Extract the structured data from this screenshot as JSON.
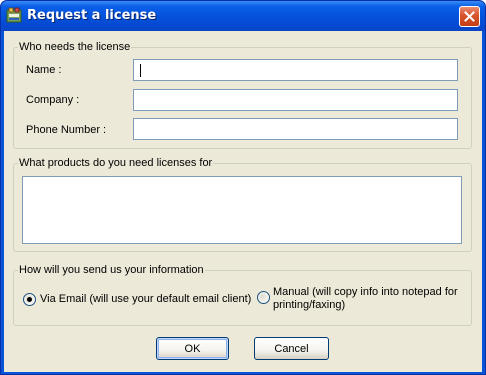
{
  "window": {
    "title": "Request a license",
    "app_icon": "license-app-icon",
    "close_icon": "close-icon"
  },
  "who": {
    "legend": "Who needs the license",
    "name_label": "Name :",
    "company_label": "Company :",
    "phone_label": "Phone Number :",
    "name_value": "",
    "company_value": "",
    "phone_value": ""
  },
  "products": {
    "legend": "What products do you need licenses for",
    "value": ""
  },
  "send": {
    "legend": "How will you send us your information",
    "email_label": "Via Email (will use your default email client)",
    "manual_label": "Manual (will copy info into notepad for printing/faxing)",
    "selected": "email"
  },
  "buttons": {
    "ok": "OK",
    "cancel": "Cancel"
  },
  "colors": {
    "titlebar": "#0553dc",
    "dialog_bg": "#ece9d8",
    "input_border": "#7f9db9",
    "group_border": "#d0d0bf",
    "close_button": "#d8542e"
  }
}
